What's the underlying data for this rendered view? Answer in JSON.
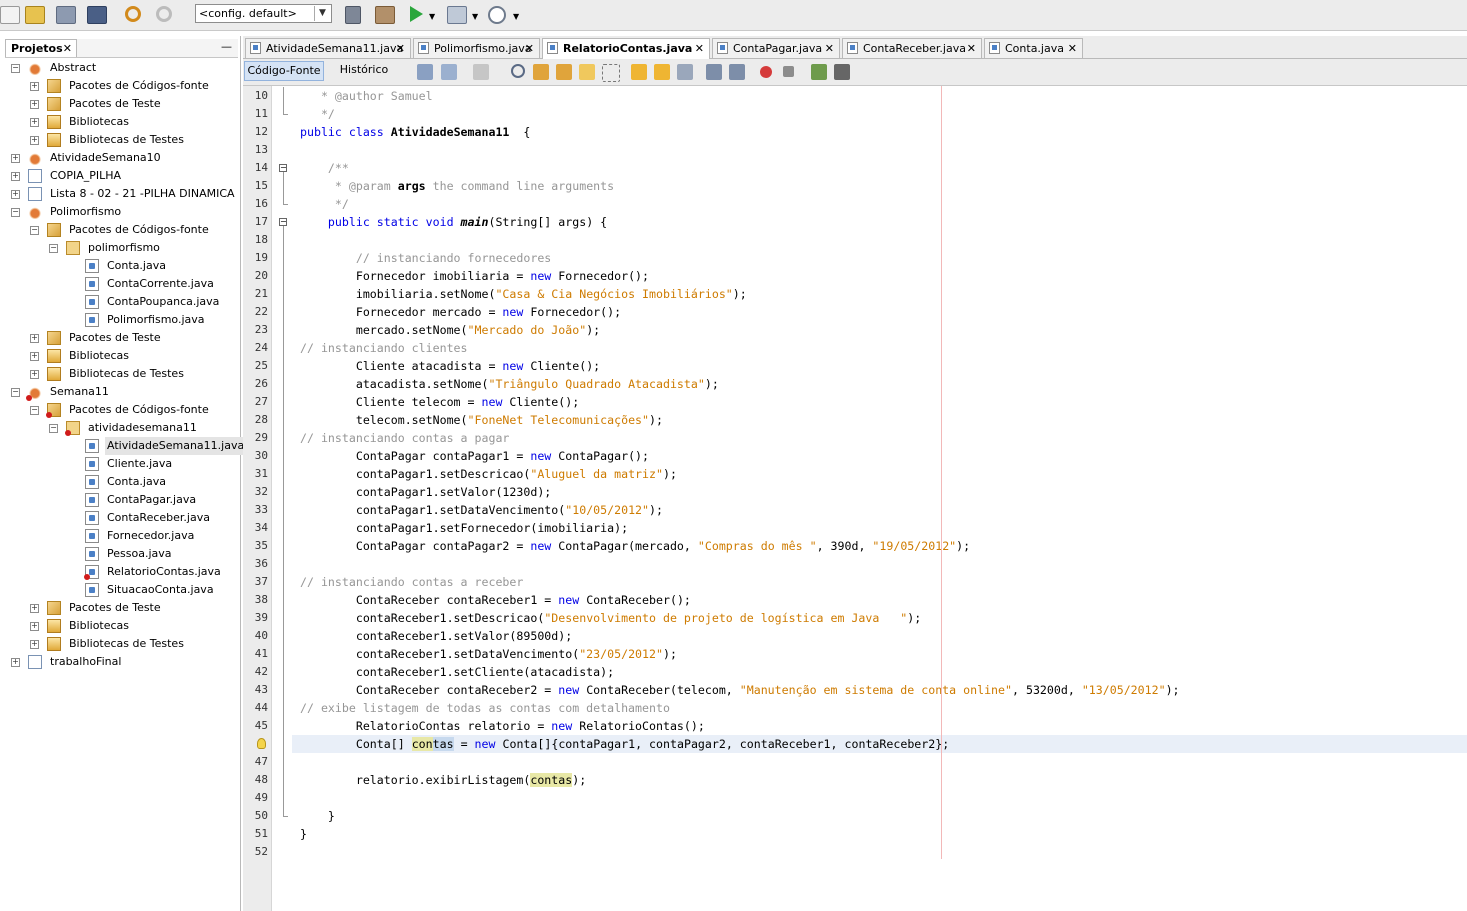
{
  "toolbar": {
    "config_value": "<config. default>"
  },
  "projects_panel": {
    "tab_label": "Projetos",
    "close": "✕",
    "minimize": "—",
    "tree": [
      {
        "label": "Abstract",
        "depth": 0,
        "icon": "proj",
        "expander": "−"
      },
      {
        "label": "Pacotes de Códigos-fonte",
        "depth": 1,
        "icon": "pkgs",
        "expander": "+"
      },
      {
        "label": "Pacotes de Teste",
        "depth": 1,
        "icon": "pkgs",
        "expander": "+"
      },
      {
        "label": "Bibliotecas",
        "depth": 1,
        "icon": "lib",
        "expander": "+"
      },
      {
        "label": "Bibliotecas de Testes",
        "depth": 1,
        "icon": "lib",
        "expander": "+"
      },
      {
        "label": "AtividadeSemana10",
        "depth": 0,
        "icon": "proj",
        "expander": "+"
      },
      {
        "label": "COPIA_PILHA",
        "depth": 0,
        "icon": "projlib",
        "expander": "+"
      },
      {
        "label": "Lista 8 - 02 - 21 -PILHA DINAMICA",
        "depth": 0,
        "icon": "projlib",
        "expander": "+"
      },
      {
        "label": "Polimorfismo",
        "depth": 0,
        "icon": "proj",
        "expander": "−"
      },
      {
        "label": "Pacotes de Códigos-fonte",
        "depth": 1,
        "icon": "pkgs",
        "expander": "−"
      },
      {
        "label": "polimorfismo",
        "depth": 2,
        "icon": "pkg",
        "expander": "−"
      },
      {
        "label": "Conta.java",
        "depth": 3,
        "icon": "java",
        "expander": ""
      },
      {
        "label": "ContaCorrente.java",
        "depth": 3,
        "icon": "java",
        "expander": ""
      },
      {
        "label": "ContaPoupanca.java",
        "depth": 3,
        "icon": "java",
        "expander": ""
      },
      {
        "label": "Polimorfismo.java",
        "depth": 3,
        "icon": "java",
        "expander": ""
      },
      {
        "label": "Pacotes de Teste",
        "depth": 1,
        "icon": "pkgs",
        "expander": "+"
      },
      {
        "label": "Bibliotecas",
        "depth": 1,
        "icon": "lib",
        "expander": "+"
      },
      {
        "label": "Bibliotecas de Testes",
        "depth": 1,
        "icon": "lib",
        "expander": "+"
      },
      {
        "label": "Semana11",
        "depth": 0,
        "icon": "proj",
        "expander": "−",
        "error": true
      },
      {
        "label": "Pacotes de Códigos-fonte",
        "depth": 1,
        "icon": "pkgs",
        "expander": "−",
        "error": true
      },
      {
        "label": "atividadesemana11",
        "depth": 2,
        "icon": "pkg",
        "expander": "−",
        "error": true
      },
      {
        "label": "AtividadeSemana11.java",
        "depth": 3,
        "icon": "java",
        "expander": "",
        "selected": true
      },
      {
        "label": "Cliente.java",
        "depth": 3,
        "icon": "java",
        "expander": ""
      },
      {
        "label": "Conta.java",
        "depth": 3,
        "icon": "java",
        "expander": ""
      },
      {
        "label": "ContaPagar.java",
        "depth": 3,
        "icon": "java",
        "expander": ""
      },
      {
        "label": "ContaReceber.java",
        "depth": 3,
        "icon": "java",
        "expander": ""
      },
      {
        "label": "Fornecedor.java",
        "depth": 3,
        "icon": "java",
        "expander": ""
      },
      {
        "label": "Pessoa.java",
        "depth": 3,
        "icon": "java",
        "expander": ""
      },
      {
        "label": "RelatorioContas.java",
        "depth": 3,
        "icon": "java",
        "expander": "",
        "error": true
      },
      {
        "label": "SituacaoConta.java",
        "depth": 3,
        "icon": "java",
        "expander": ""
      },
      {
        "label": "Pacotes de Teste",
        "depth": 1,
        "icon": "pkgs",
        "expander": "+"
      },
      {
        "label": "Bibliotecas",
        "depth": 1,
        "icon": "lib",
        "expander": "+"
      },
      {
        "label": "Bibliotecas de Testes",
        "depth": 1,
        "icon": "lib",
        "expander": "+"
      },
      {
        "label": "trabalhoFinal",
        "depth": 0,
        "icon": "projlib",
        "expander": "+"
      }
    ]
  },
  "editor": {
    "tabs": [
      {
        "label": "AtividadeSemana11.java",
        "active": false
      },
      {
        "label": "Polimorfismo.java",
        "active": false
      },
      {
        "label": "RelatorioContas.java",
        "active": true
      },
      {
        "label": "ContaPagar.java",
        "active": false
      },
      {
        "label": "ContaReceber.java",
        "active": false
      },
      {
        "label": "Conta.java",
        "active": false
      }
    ],
    "tab_close": "✕",
    "source_tab": "Código-Fonte",
    "history_tab": "Histórico",
    "first_line": 10,
    "current_line": 46,
    "lines": [
      [
        [
          "cm",
          "   * @author Samuel"
        ]
      ],
      [
        [
          "cm",
          "   */"
        ]
      ],
      [
        [
          "kw",
          "public class "
        ],
        [
          "b",
          "AtividadeSemana11"
        ],
        [
          "",
          "  {"
        ]
      ],
      [
        [
          "",
          ""
        ]
      ],
      [
        [
          "cm",
          "    /**"
        ]
      ],
      [
        [
          "cm",
          "     * @param "
        ],
        [
          "b",
          "args"
        ],
        [
          "cm",
          " the command line arguments"
        ]
      ],
      [
        [
          "cm",
          "     */"
        ]
      ],
      [
        [
          "kw",
          "    public static void "
        ],
        [
          "bi",
          "main"
        ],
        [
          "",
          "(String[] args) {"
        ]
      ],
      [
        [
          "",
          ""
        ]
      ],
      [
        [
          "cm",
          "        // instanciando fornecedores"
        ]
      ],
      [
        [
          "",
          "        Fornecedor imobiliaria = "
        ],
        [
          "kw",
          "new"
        ],
        [
          "",
          " Fornecedor();"
        ]
      ],
      [
        [
          "",
          "        imobiliaria.setNome("
        ],
        [
          "st",
          "\"Casa & Cia Negócios Imobiliários\""
        ],
        [
          "",
          ");"
        ]
      ],
      [
        [
          "",
          "        Fornecedor mercado = "
        ],
        [
          "kw",
          "new"
        ],
        [
          "",
          " Fornecedor();"
        ]
      ],
      [
        [
          "",
          "        mercado.setNome("
        ],
        [
          "st",
          "\"Mercado do João\""
        ],
        [
          "",
          ");"
        ]
      ],
      [
        [
          "cm",
          "// instanciando clientes"
        ]
      ],
      [
        [
          "",
          "        Cliente atacadista = "
        ],
        [
          "kw",
          "new"
        ],
        [
          "",
          " Cliente();"
        ]
      ],
      [
        [
          "",
          "        atacadista.setNome("
        ],
        [
          "st",
          "\"Triângulo Quadrado Atacadista\""
        ],
        [
          "",
          ");"
        ]
      ],
      [
        [
          "",
          "        Cliente telecom = "
        ],
        [
          "kw",
          "new"
        ],
        [
          "",
          " Cliente();"
        ]
      ],
      [
        [
          "",
          "        telecom.setNome("
        ],
        [
          "st",
          "\"FoneNet Telecomunicações\""
        ],
        [
          "",
          ");"
        ]
      ],
      [
        [
          "cm",
          "// instanciando contas a pagar"
        ]
      ],
      [
        [
          "",
          "        ContaPagar contaPagar1 = "
        ],
        [
          "kw",
          "new"
        ],
        [
          "",
          " ContaPagar();"
        ]
      ],
      [
        [
          "",
          "        contaPagar1.setDescricao("
        ],
        [
          "st",
          "\"Aluguel da matriz\""
        ],
        [
          "",
          ");"
        ]
      ],
      [
        [
          "",
          "        contaPagar1.setValor(1230d);"
        ]
      ],
      [
        [
          "",
          "        contaPagar1.setDataVencimento("
        ],
        [
          "st",
          "\"10/05/2012\""
        ],
        [
          "",
          ");"
        ]
      ],
      [
        [
          "",
          "        contaPagar1.setFornecedor(imobiliaria);"
        ]
      ],
      [
        [
          "",
          "        ContaPagar contaPagar2 = "
        ],
        [
          "kw",
          "new"
        ],
        [
          "",
          " ContaPagar(mercado, "
        ],
        [
          "st",
          "\"Compras do mês \""
        ],
        [
          "",
          ", 390d, "
        ],
        [
          "st",
          "\"19/05/2012\""
        ],
        [
          "",
          ");"
        ]
      ],
      [
        [
          "",
          ""
        ]
      ],
      [
        [
          "cm",
          "// instanciando contas a receber"
        ]
      ],
      [
        [
          "",
          "        ContaReceber contaReceber1 = "
        ],
        [
          "kw",
          "new"
        ],
        [
          "",
          " ContaReceber();"
        ]
      ],
      [
        [
          "",
          "        contaReceber1.setDescricao("
        ],
        [
          "st",
          "\"Desenvolvimento de projeto de logística em Java   \""
        ],
        [
          "",
          ");"
        ]
      ],
      [
        [
          "",
          "        contaReceber1.setValor(89500d);"
        ]
      ],
      [
        [
          "",
          "        contaReceber1.setDataVencimento("
        ],
        [
          "st",
          "\"23/05/2012\""
        ],
        [
          "",
          ");"
        ]
      ],
      [
        [
          "",
          "        contaReceber1.setCliente(atacadista);"
        ]
      ],
      [
        [
          "",
          "        ContaReceber contaReceber2 = "
        ],
        [
          "kw",
          "new"
        ],
        [
          "",
          " ContaReceber(telecom, "
        ],
        [
          "st",
          "\"Manutenção em sistema de conta online\""
        ],
        [
          "",
          ", 53200d, "
        ],
        [
          "st",
          "\"13/05/2012\""
        ],
        [
          "",
          ");"
        ]
      ],
      [
        [
          "cm",
          "// exibe listagem de todas as contas com detalhamento"
        ]
      ],
      [
        [
          "",
          "        RelatorioContas relatorio = "
        ],
        [
          "kw",
          "new"
        ],
        [
          "",
          " RelatorioContas();"
        ]
      ],
      [
        [
          "",
          "        Conta[] "
        ],
        [
          "hl",
          "con"
        ],
        [
          "hlc",
          "tas"
        ],
        [
          "",
          " = "
        ],
        [
          "kw",
          "new"
        ],
        [
          "",
          " Conta[]{contaPagar1, contaPagar2, contaReceber1, contaReceber2};"
        ]
      ],
      [
        [
          "",
          ""
        ]
      ],
      [
        [
          "",
          "        relatorio.exibirListagem("
        ],
        [
          "hl",
          "contas"
        ],
        [
          "",
          ");"
        ]
      ],
      [
        [
          "",
          ""
        ]
      ],
      [
        [
          "",
          "    }"
        ]
      ],
      [
        [
          "",
          "}"
        ]
      ],
      [
        [
          "",
          ""
        ]
      ]
    ]
  }
}
